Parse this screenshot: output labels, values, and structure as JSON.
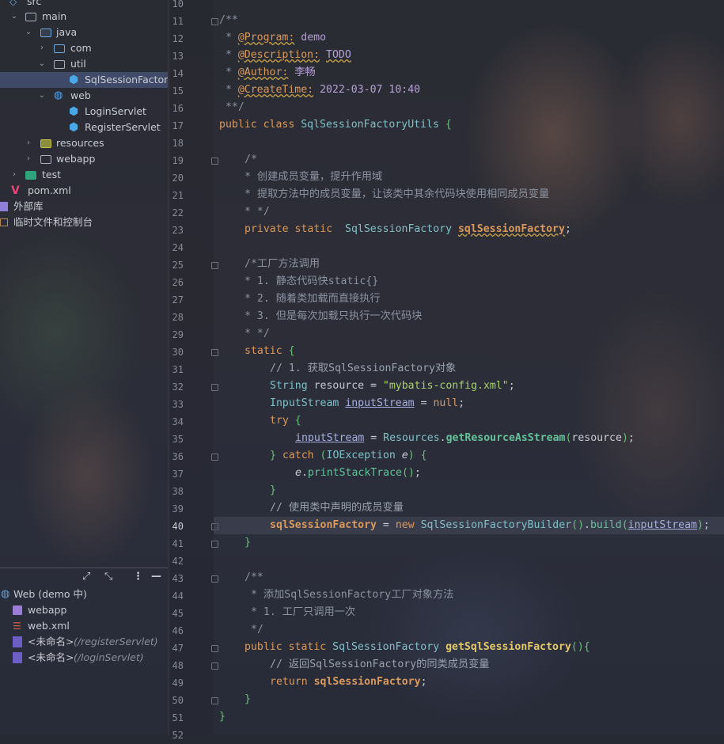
{
  "project_tree": {
    "items": [
      {
        "label": "src",
        "depth": 0
      },
      {
        "label": "main",
        "depth": 1
      },
      {
        "label": "java",
        "depth": 2
      },
      {
        "label": "com",
        "depth": 3
      },
      {
        "label": "util",
        "depth": 3
      },
      {
        "label": "SqlSessionFactory",
        "depth": 4
      },
      {
        "label": "web",
        "depth": 3
      },
      {
        "label": "LoginServlet",
        "depth": 4
      },
      {
        "label": "RegisterServlet",
        "depth": 4
      },
      {
        "label": "resources",
        "depth": 2
      },
      {
        "label": "webapp",
        "depth": 2
      },
      {
        "label": "test",
        "depth": 1
      },
      {
        "label": "pom.xml",
        "depth": 1
      },
      {
        "label": "外部库",
        "depth": 0
      },
      {
        "label": "临时文件和控制台",
        "depth": 0
      }
    ]
  },
  "web_panel": {
    "root_label": "Web (demo 中)",
    "items": [
      {
        "label": "webapp",
        "hint": ""
      },
      {
        "label": "web.xml",
        "hint": ""
      },
      {
        "label": "<未命名>",
        "hint": "(/registerServlet)"
      },
      {
        "label": "<未命名>",
        "hint": "(/loginServlet)"
      }
    ]
  },
  "editor": {
    "current_line": "40",
    "line_numbers": [
      "10",
      "11",
      "12",
      "13",
      "14",
      "15",
      "16",
      "17",
      "18",
      "19",
      "20",
      "21",
      "22",
      "23",
      "24",
      "25",
      "26",
      "27",
      "28",
      "29",
      "30",
      "31",
      "32",
      "33",
      "34",
      "35",
      "36",
      "37",
      "38",
      "39",
      "40",
      "41",
      "42",
      "43",
      "44",
      "45",
      "46",
      "47",
      "48",
      "49",
      "50",
      "51",
      "52"
    ],
    "code": {
      "program_tag": "@Program:",
      "program_val": "demo",
      "description_tag": "@Description:",
      "description_val": "TODO",
      "author_tag": "@Author:",
      "author_val": "李畅",
      "createtime_tag": "@CreateTime:",
      "createtime_val": "2022-03-07 10:40",
      "class_name": "SqlSessionFactoryUtils",
      "c20": "* 创建成员变量，提升作用域",
      "c21": "* 提取方法中的成员变量，让该类中其余代码块使用相同成员变量",
      "c25": "/*工厂方法调用",
      "c26": "* 1. 静态代码快static{}",
      "c27": "* 2. 随着类加载而直接执行",
      "c28": "* 3. 但是每次加载只执行一次代码块",
      "c31": "// 1. 获取SqlSessionFactory对象",
      "c39": "// 使用类中声明的成员变量",
      "c44": "* 添加SqlSessionFactory工厂对象方法",
      "c45": "* 1. 工厂只调用一次",
      "c48": "// 返回SqlSessionFactory的同类成员变量",
      "config_string": "\"mybatis-config.xml\""
    }
  }
}
